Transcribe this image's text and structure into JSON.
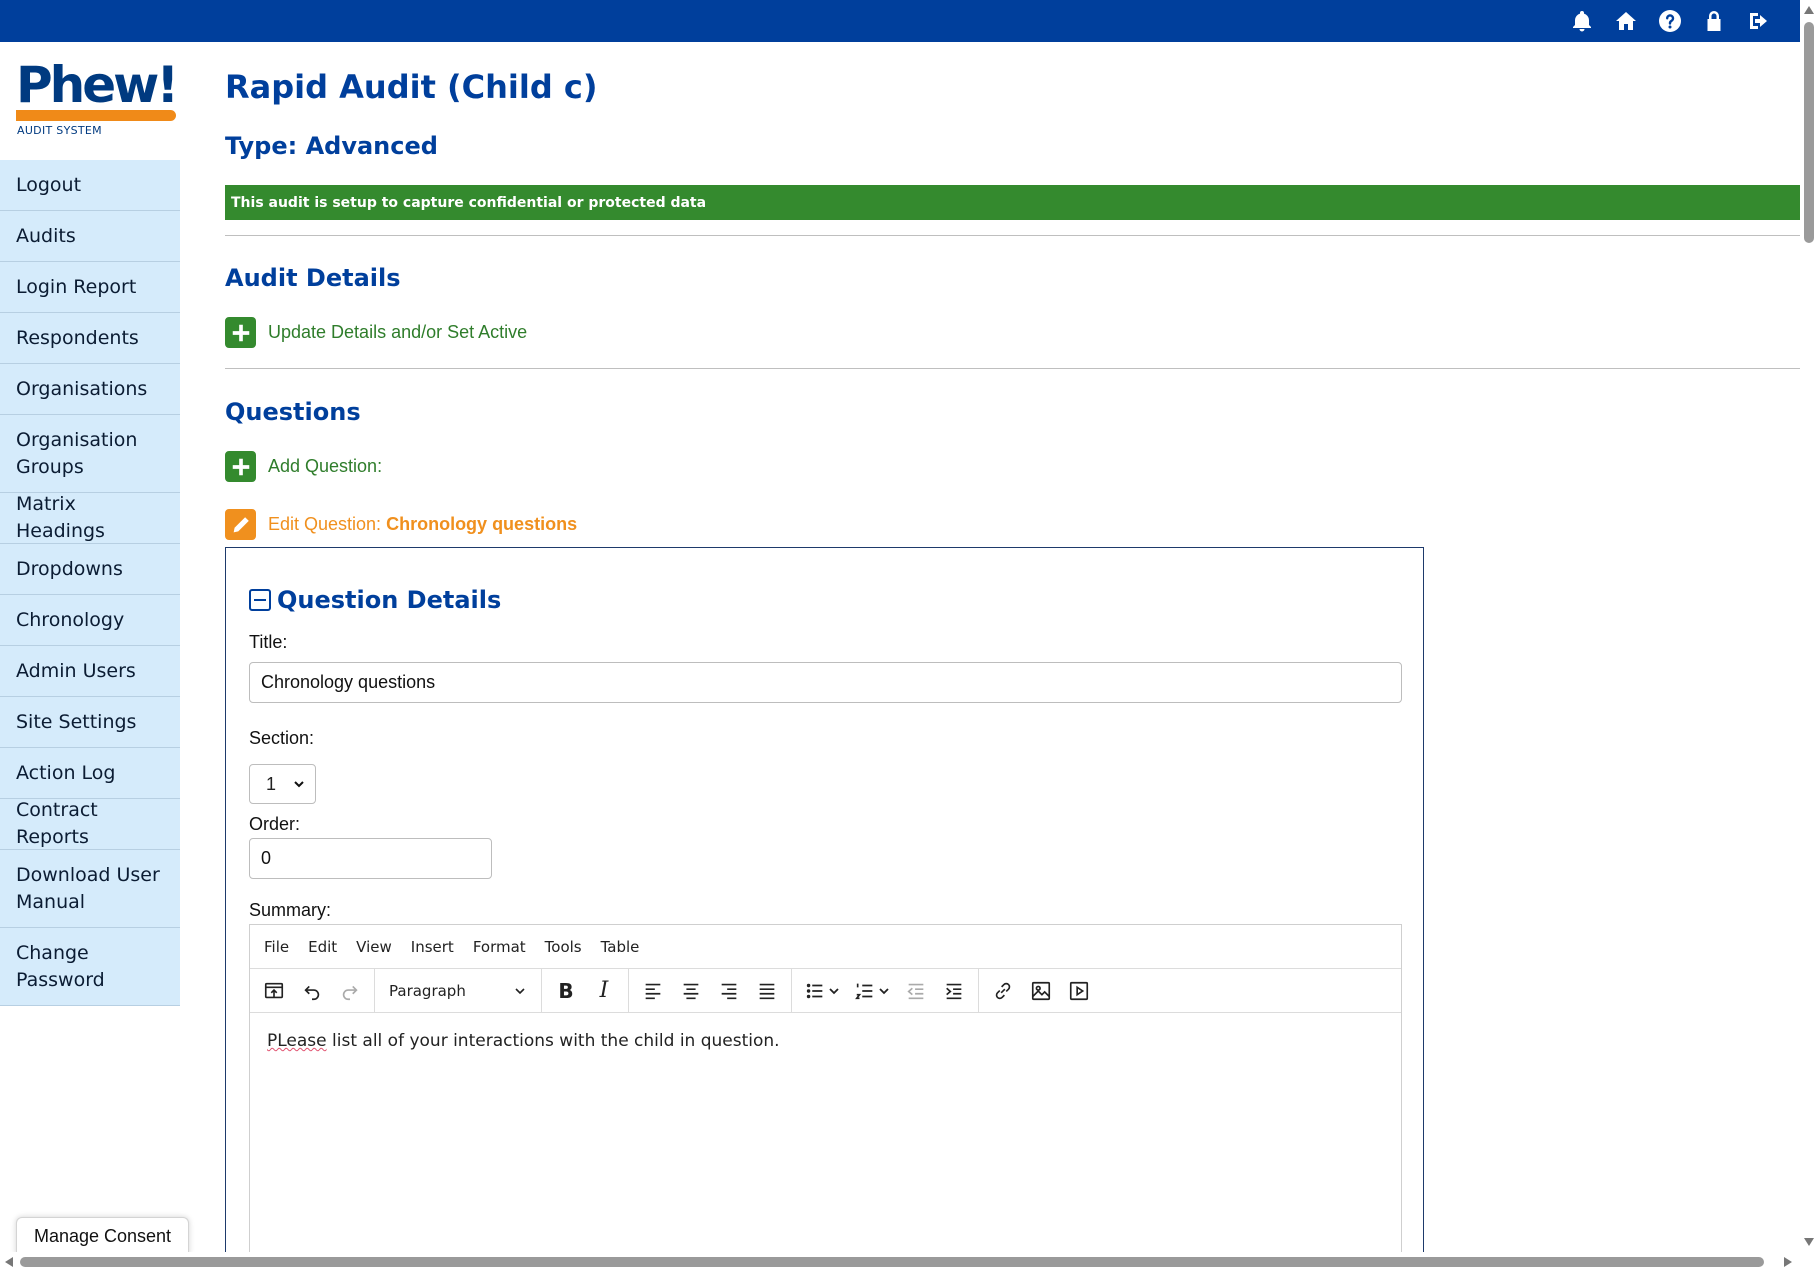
{
  "brand": {
    "logo_text": "Phew!",
    "logo_subtitle": "AUDIT SYSTEM",
    "primary_color": "#003f9c",
    "accent_color": "#f08a18",
    "success_color": "#348a2e"
  },
  "topbar": {
    "icons": [
      "bell-icon",
      "home-icon",
      "help-icon",
      "lock-icon",
      "logout-icon"
    ]
  },
  "sidebar": {
    "items": [
      {
        "label": "Logout"
      },
      {
        "label": "Audits"
      },
      {
        "label": "Login Report"
      },
      {
        "label": "Respondents"
      },
      {
        "label": "Organisations"
      },
      {
        "label": "Organisation Groups"
      },
      {
        "label": "Matrix Headings"
      },
      {
        "label": "Dropdowns"
      },
      {
        "label": "Chronology"
      },
      {
        "label": "Admin Users"
      },
      {
        "label": "Site Settings"
      },
      {
        "label": "Action Log"
      },
      {
        "label": "Contract Reports"
      },
      {
        "label": "Download User Manual"
      },
      {
        "label": "Change Password"
      }
    ]
  },
  "manage_consent": "Manage Consent",
  "main": {
    "title": "Rapid Audit (Child c)",
    "type": "Type: Advanced",
    "notice": "This audit is setup to capture confidential or protected data",
    "audit_details_heading": "Audit Details",
    "update_details_link": "Update Details and/or Set Active",
    "questions_heading": "Questions",
    "add_question_link": "Add Question:",
    "edit_question_prefix": "Edit Question:",
    "edit_question_name": "Chronology questions"
  },
  "question_details": {
    "heading": "Question Details",
    "title_label": "Title:",
    "title_value": "Chronology questions",
    "section_label": "Section:",
    "section_value": "1",
    "order_label": "Order:",
    "order_value": "0",
    "summary_label": "Summary:"
  },
  "editor": {
    "menu": [
      "File",
      "Edit",
      "View",
      "Insert",
      "Format",
      "Tools",
      "Table"
    ],
    "block_format": "Paragraph",
    "bold_glyph": "B",
    "italic_glyph": "I",
    "content_misspelled": "PLease",
    "content_rest": " list all of your interactions with the child in question."
  }
}
